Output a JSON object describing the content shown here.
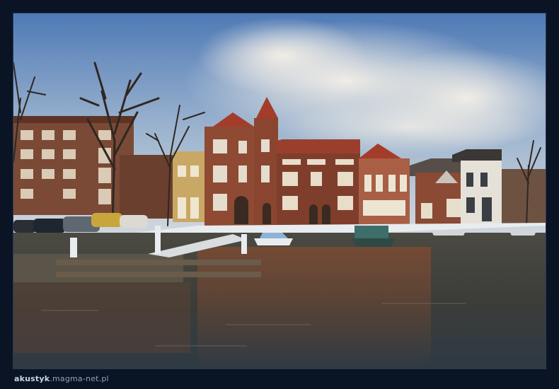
{
  "photo": {
    "subject": "canal-side row of brick townhouses with reflections",
    "colors": {
      "sky_top": "#5f86bd",
      "sky_bottom": "#b9c8d9",
      "cloud": "#e6e2dc",
      "brick": "#8a4a34",
      "brick_dark": "#5e3326",
      "roof": "#a43c2a",
      "water": "#3b3c38",
      "snow": "#e8ecef",
      "page_bg": "#0b1424"
    }
  },
  "watermark": {
    "name": "akustyk",
    "domain": ".magma-net.pl"
  }
}
